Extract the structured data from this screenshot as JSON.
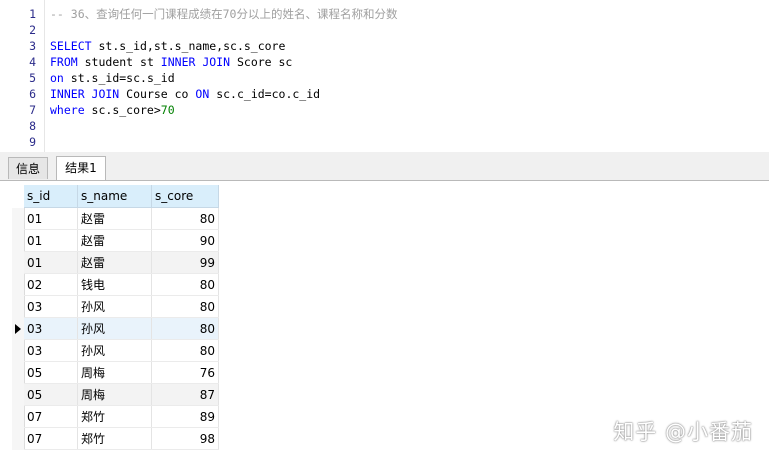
{
  "editor": {
    "lines": [
      {
        "n": "1",
        "segments": [
          {
            "t": "-- 36、查询任何一门课程成绩在70分以上的姓名、课程名称和分数",
            "c": "cm"
          }
        ]
      },
      {
        "n": "2",
        "segments": []
      },
      {
        "n": "3",
        "segments": [
          {
            "t": "SELECT",
            "c": "kw"
          },
          {
            "t": " st.s_id,st.s_name,sc.s_core",
            "c": ""
          }
        ]
      },
      {
        "n": "4",
        "segments": [
          {
            "t": "FROM",
            "c": "kw"
          },
          {
            "t": " student st ",
            "c": ""
          },
          {
            "t": "INNER JOIN",
            "c": "kw"
          },
          {
            "t": " Score sc",
            "c": ""
          }
        ]
      },
      {
        "n": "5",
        "segments": [
          {
            "t": "on",
            "c": "kw"
          },
          {
            "t": " st.s_id=sc.s_id",
            "c": ""
          }
        ]
      },
      {
        "n": "6",
        "segments": [
          {
            "t": "INNER JOIN",
            "c": "kw"
          },
          {
            "t": " Course co ",
            "c": ""
          },
          {
            "t": "ON",
            "c": "kw"
          },
          {
            "t": " sc.c_id=co.c_id",
            "c": ""
          }
        ]
      },
      {
        "n": "7",
        "segments": [
          {
            "t": "where",
            "c": "kw"
          },
          {
            "t": " sc.s_core>",
            "c": ""
          },
          {
            "t": "70",
            "c": "num"
          }
        ]
      },
      {
        "n": "8",
        "segments": []
      },
      {
        "n": "9",
        "segments": []
      }
    ]
  },
  "tabs": {
    "info": "信息",
    "result": "结果1"
  },
  "grid": {
    "columns": [
      "s_id",
      "s_name",
      "s_core"
    ],
    "rows": [
      [
        "01",
        "赵雷",
        "80"
      ],
      [
        "01",
        "赵雷",
        "90"
      ],
      [
        "01",
        "赵雷",
        "99"
      ],
      [
        "02",
        "钱电",
        "80"
      ],
      [
        "03",
        "孙风",
        "80"
      ],
      [
        "03",
        "孙风",
        "80"
      ],
      [
        "03",
        "孙风",
        "80"
      ],
      [
        "05",
        "周梅",
        "76"
      ],
      [
        "05",
        "周梅",
        "87"
      ],
      [
        "07",
        "郑竹",
        "89"
      ],
      [
        "07",
        "郑竹",
        "98"
      ]
    ],
    "selected_row": 5,
    "alt_rows": [
      2,
      8
    ]
  },
  "watermark": "知乎 @小番茄",
  "colors": {
    "keyword": "#0000ff",
    "comment": "#a0a0a0",
    "number": "#008000",
    "header_bg": "#d9eefb"
  }
}
